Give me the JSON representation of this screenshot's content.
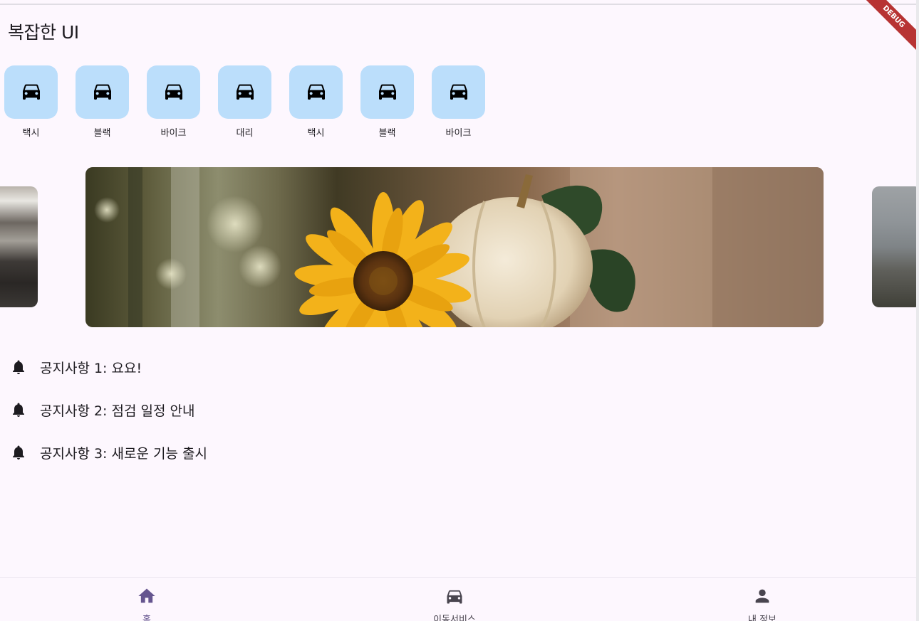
{
  "app": {
    "title": "복잡한 UI",
    "debug_banner": "DEBUG"
  },
  "services": [
    {
      "label": "택시",
      "icon": "car-icon"
    },
    {
      "label": "블랙",
      "icon": "car-icon"
    },
    {
      "label": "바이크",
      "icon": "car-icon"
    },
    {
      "label": "대리",
      "icon": "car-icon"
    },
    {
      "label": "택시",
      "icon": "car-icon"
    },
    {
      "label": "블랙",
      "icon": "car-icon"
    },
    {
      "label": "바이크",
      "icon": "car-icon"
    }
  ],
  "notices": [
    {
      "text": "공지사항 1: 요요!",
      "icon": "bell-icon"
    },
    {
      "text": "공지사항 2: 점검 일정 안내",
      "icon": "bell-icon"
    },
    {
      "text": "공지사항 3: 새로운 기능 출시",
      "icon": "bell-icon"
    }
  ],
  "bottom_nav": [
    {
      "label": "홈",
      "icon": "home-icon",
      "active": true
    },
    {
      "label": "이동서비스",
      "icon": "car-icon",
      "active": false
    },
    {
      "label": "내 정보",
      "icon": "person-icon",
      "active": false
    }
  ],
  "colors": {
    "background": "#fdf7fe",
    "tile": "#bbdefb",
    "nav_active": "#65558f",
    "nav_inactive": "#49454f",
    "debug": "#b73333"
  }
}
